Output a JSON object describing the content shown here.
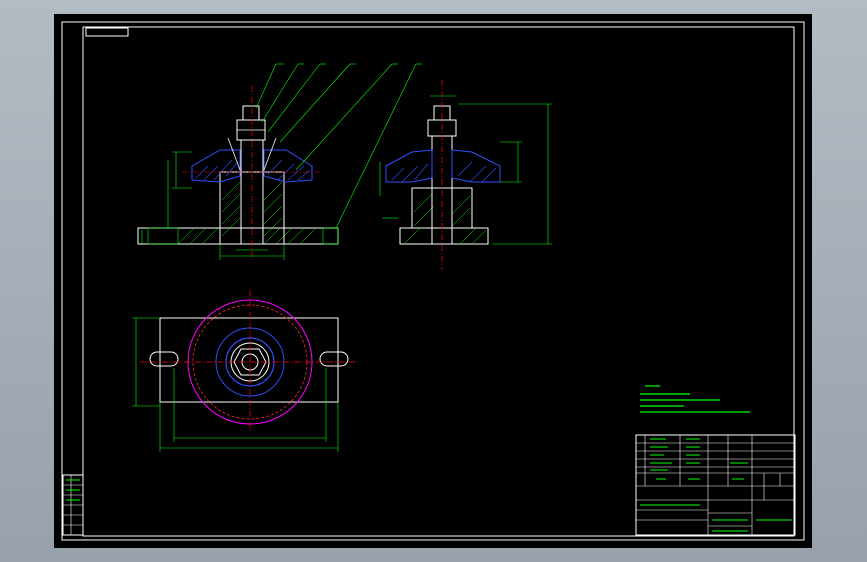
{
  "colors": {
    "background": "#000000",
    "frame": "#ffffff",
    "dimension": "#00ff00",
    "hatch": "#00ff00",
    "section_blue": "#3050ff",
    "centerline": "#ff0000",
    "outline": "#ffffff",
    "magenta": "#ff00ff",
    "notes": "#00ff00",
    "viewport_bg": "#a3acb6"
  },
  "icons": [
    "cad-drawing-sheet"
  ]
}
